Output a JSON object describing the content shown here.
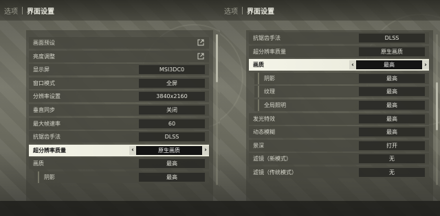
{
  "left": {
    "breadcrumb": {
      "parent": "选项",
      "current": "界面设置"
    },
    "rows": [
      {
        "name": "graphics-preset",
        "label": "画面预设",
        "external": true
      },
      {
        "name": "brightness",
        "label": "亮度调整",
        "external": true
      },
      {
        "name": "display",
        "label": "显示屏",
        "value": "MSI3DC0"
      },
      {
        "name": "window-mode",
        "label": "窗口模式",
        "value": "全屏"
      },
      {
        "name": "resolution",
        "label": "分辨率设置",
        "value": "3840x2160"
      },
      {
        "name": "vsync",
        "label": "垂直同步",
        "value": "关闭"
      },
      {
        "name": "max-fps",
        "label": "最大帧速率",
        "value": "60"
      },
      {
        "name": "anti-aliasing",
        "label": "抗锯齿手法",
        "value": "DLSS"
      },
      {
        "name": "super-resolution-quality",
        "label": "超分辨率质量",
        "value": "原生画质",
        "highlight": true
      },
      {
        "name": "image-quality",
        "label": "画质",
        "value": "最高"
      },
      {
        "name": "shadow",
        "label": "阴影",
        "value": "最高",
        "sub": true
      }
    ]
  },
  "right": {
    "breadcrumb": {
      "parent": "选项",
      "current": "界面设置"
    },
    "rows": [
      {
        "name": "anti-aliasing",
        "label": "抗锯齿手法",
        "value": "DLSS"
      },
      {
        "name": "super-resolution-quality",
        "label": "超分辨率质量",
        "value": "原生画质"
      },
      {
        "name": "image-quality",
        "label": "画质",
        "value": "最高",
        "highlight": true
      },
      {
        "name": "shadow",
        "label": "阴影",
        "value": "最高",
        "sub": true
      },
      {
        "name": "texture",
        "label": "纹理",
        "value": "最高",
        "sub": true
      },
      {
        "name": "global-illumination",
        "label": "全局照明",
        "value": "最高",
        "sub": true
      },
      {
        "name": "bloom",
        "label": "发光特效",
        "value": "最高"
      },
      {
        "name": "motion-blur",
        "label": "动态模糊",
        "value": "最高"
      },
      {
        "name": "depth-of-field",
        "label": "景深",
        "value": "打开"
      },
      {
        "name": "filter-new",
        "label": "滤镜（新模式）",
        "value": "无"
      },
      {
        "name": "filter-classic",
        "label": "滤镜（传统模式）",
        "value": "无"
      }
    ]
  },
  "icons": {
    "external": "external-link-icon",
    "prev": "chevron-left-icon",
    "next": "chevron-right-icon"
  },
  "glyphs": {
    "prev": "‹",
    "next": "›"
  }
}
